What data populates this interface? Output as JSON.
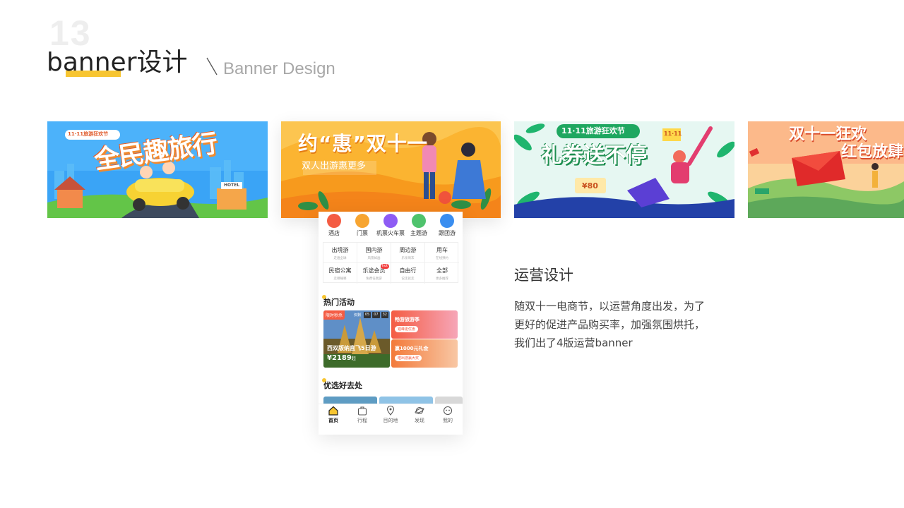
{
  "header": {
    "page_number": "13",
    "title": "banner设计",
    "subtitle": "Banner Design",
    "accent_color": "#f7c531"
  },
  "banners": [
    {
      "headline": "全民趣旅行",
      "tag": "11·11旅游狂欢节",
      "sign": "HOTEL"
    },
    {
      "headline": "约“惠”双十一",
      "subline": "双人出游惠更多"
    },
    {
      "headline": "礼券送不停",
      "tag": "11·11旅游狂欢节",
      "coupon": "¥80",
      "coupon_tag": "11·11"
    },
    {
      "headline": "双十一狂欢",
      "headline2": "红包放肆"
    }
  ],
  "phone": {
    "top_icons": [
      {
        "label": "酒店",
        "icon": "hotel-icon",
        "color": "#f45c43"
      },
      {
        "label": "门票",
        "icon": "ticket-icon",
        "color": "#f7a531"
      },
      {
        "label": "机票火车票",
        "icon": "plane-icon",
        "color": "#8e5cf4"
      },
      {
        "label": "主题游",
        "icon": "diamond-icon",
        "color": "#4fc36d"
      },
      {
        "label": "跟团游",
        "icon": "flag-icon",
        "color": "#3a8ef0"
      }
    ],
    "grid": [
      {
        "title": "出境游",
        "sub": "走遍全球"
      },
      {
        "title": "国内游",
        "sub": "风景如画"
      },
      {
        "title": "周边游",
        "sub": "乐享周末"
      },
      {
        "title": "用车",
        "sub": "在线预约"
      },
      {
        "title": "民宿公寓",
        "sub": "走哪睡哪"
      },
      {
        "title": "乐途会员",
        "sub": "免费任我游",
        "badge": "hot"
      },
      {
        "title": "自由行",
        "sub": "说走就走"
      },
      {
        "title": "全部",
        "sub": "更多推荐"
      }
    ],
    "hot_section": "热门活动",
    "flash": {
      "tag": "限时秒杀",
      "countdown_label": "仅剩",
      "countdown": [
        "05",
        "07",
        "32"
      ],
      "title": "西双版纳直飞5日游",
      "price": "¥2189",
      "price_suffix": "起"
    },
    "cards": [
      {
        "title": "畅游旅游季",
        "button": "错峰更优惠"
      },
      {
        "title": "赢1000元礼金",
        "button": "晒出游赢大奖"
      }
    ],
    "good_section": "优选好去处",
    "tabs": [
      {
        "label": "首页",
        "icon": "home-icon",
        "active": true
      },
      {
        "label": "行程",
        "icon": "suitcase-icon",
        "active": false
      },
      {
        "label": "目的地",
        "icon": "location-pin-icon",
        "active": false
      },
      {
        "label": "发现",
        "icon": "planet-icon",
        "active": false
      },
      {
        "label": "我的",
        "icon": "profile-icon",
        "active": false
      }
    ]
  },
  "operation": {
    "title": "运营设计",
    "description": "随双十一电商节，以运营角度出发，为了更好的促进产品购买率，加强氛围烘托，我们出了4版运营banner"
  }
}
